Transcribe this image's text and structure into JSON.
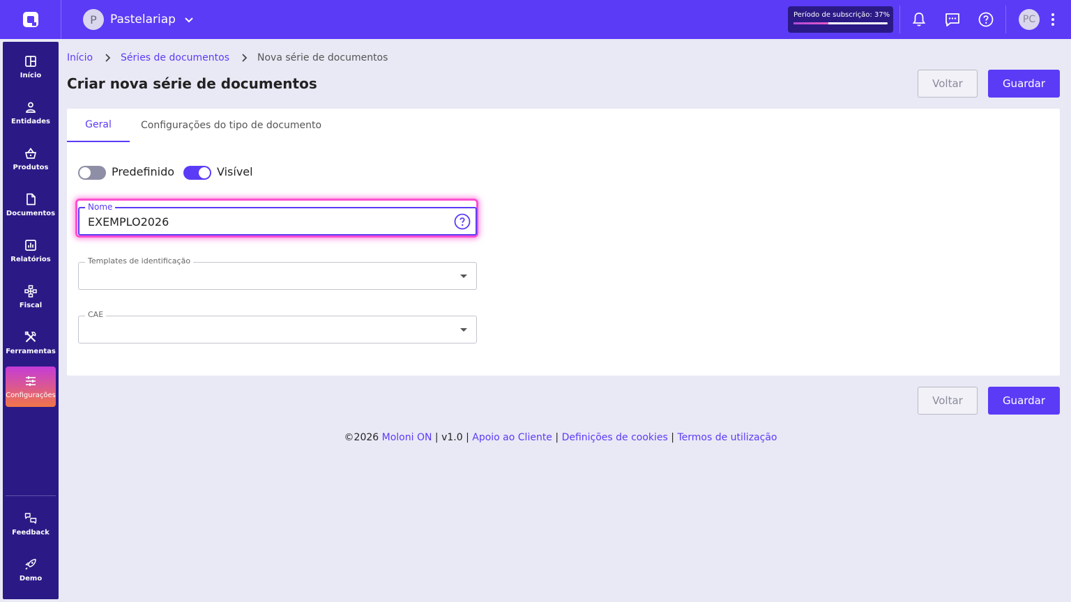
{
  "app": {
    "company_initial": "P",
    "company_name": "Pastelariap",
    "subscription_label": "Período de subscrição: 37%",
    "subscription_progress": 0.37,
    "user_initials": "PC"
  },
  "sidebar": {
    "items": [
      {
        "label": "Início",
        "icon": "home-grid-icon"
      },
      {
        "label": "Entidades",
        "icon": "person-icon"
      },
      {
        "label": "Produtos",
        "icon": "basket-icon"
      },
      {
        "label": "Documentos",
        "icon": "document-icon"
      },
      {
        "label": "Relatórios",
        "icon": "chart-icon"
      },
      {
        "label": "Fiscal",
        "icon": "sitemap-icon"
      },
      {
        "label": "Ferramentas",
        "icon": "tools-icon"
      },
      {
        "label": "Configurações",
        "icon": "sliders-icon",
        "active": true
      }
    ],
    "bottom": [
      {
        "label": "Feedback",
        "icon": "feedback-icon"
      },
      {
        "label": "Demo",
        "icon": "rocket-icon"
      }
    ]
  },
  "breadcrumb": {
    "home": "Início",
    "section": "Séries de documentos",
    "current": "Nova série de documentos"
  },
  "page": {
    "title": "Criar nova série de documentos",
    "back_label": "Voltar",
    "save_label": "Guardar"
  },
  "tabs": {
    "general": "Geral",
    "doc_type_settings": "Configurações do tipo de documento"
  },
  "form": {
    "toggle_default": {
      "label": "Predefinido",
      "on": false
    },
    "toggle_visible": {
      "label": "Visível",
      "on": true
    },
    "name": {
      "label": "Nome",
      "value": "EXEMPLO2026"
    },
    "templates": {
      "label": "Templates de identificação",
      "value": ""
    },
    "cae": {
      "label": "CAE",
      "value": ""
    }
  },
  "footer": {
    "copyright": "©2026",
    "brand": "Moloni ON",
    "version": "v1.0",
    "support": "Apoio ao Cliente",
    "cookies": "Definições de cookies",
    "terms": "Termos de utilização",
    "separator": "|"
  },
  "colors": {
    "primary": "#5b3bf6",
    "sidebar": "#2b1a86",
    "focus_glow": "#ff4fd0"
  }
}
